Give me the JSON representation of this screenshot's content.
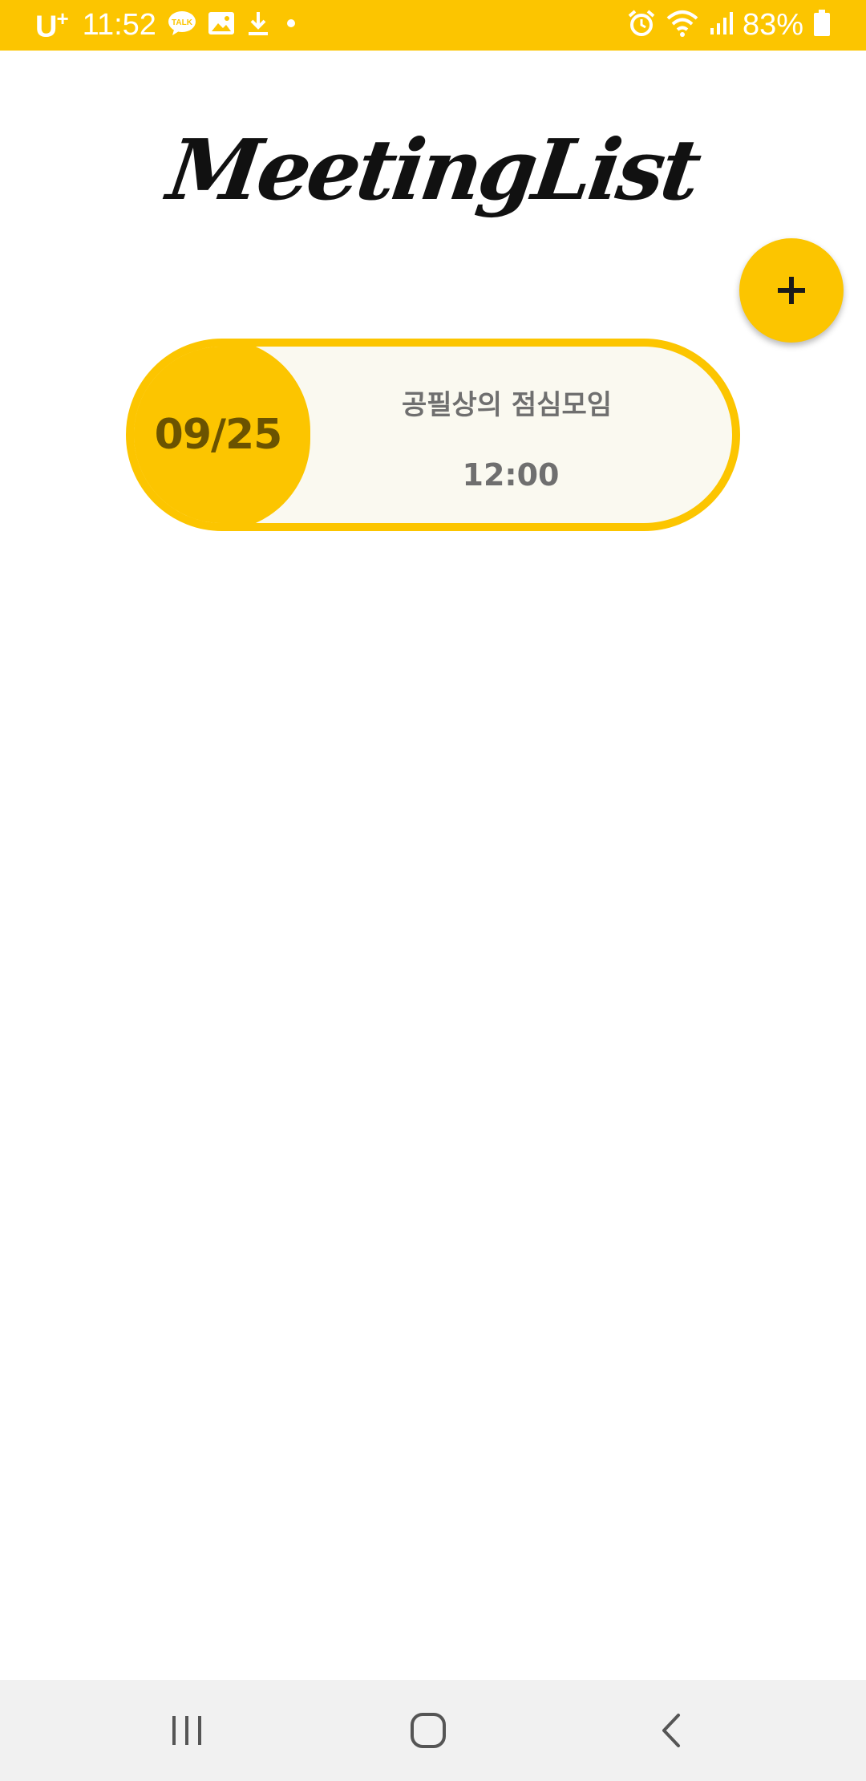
{
  "status_bar": {
    "carrier": "U",
    "carrier_sup": "+",
    "time": "11:52",
    "battery": "83%",
    "left_icons": [
      "kakaotalk-icon",
      "gallery-icon",
      "download-icon",
      "dot-icon"
    ],
    "right_icons": [
      "alarm-icon",
      "wifi-icon",
      "signal-icon",
      "battery-icon"
    ],
    "talk_label": "TALK"
  },
  "app": {
    "title": "MeetingList",
    "fab_icon": "plus-icon"
  },
  "meetings": [
    {
      "date": "09/25",
      "name": "공필상의 점심모임",
      "time": "12:00"
    }
  ],
  "nav_bar": {
    "buttons": [
      "recents",
      "home",
      "back"
    ]
  },
  "colors": {
    "accent": "#FCC500",
    "date_text": "#6B5300",
    "card_bg": "#FAF9F0",
    "nav_bg": "#F1F1F1"
  }
}
